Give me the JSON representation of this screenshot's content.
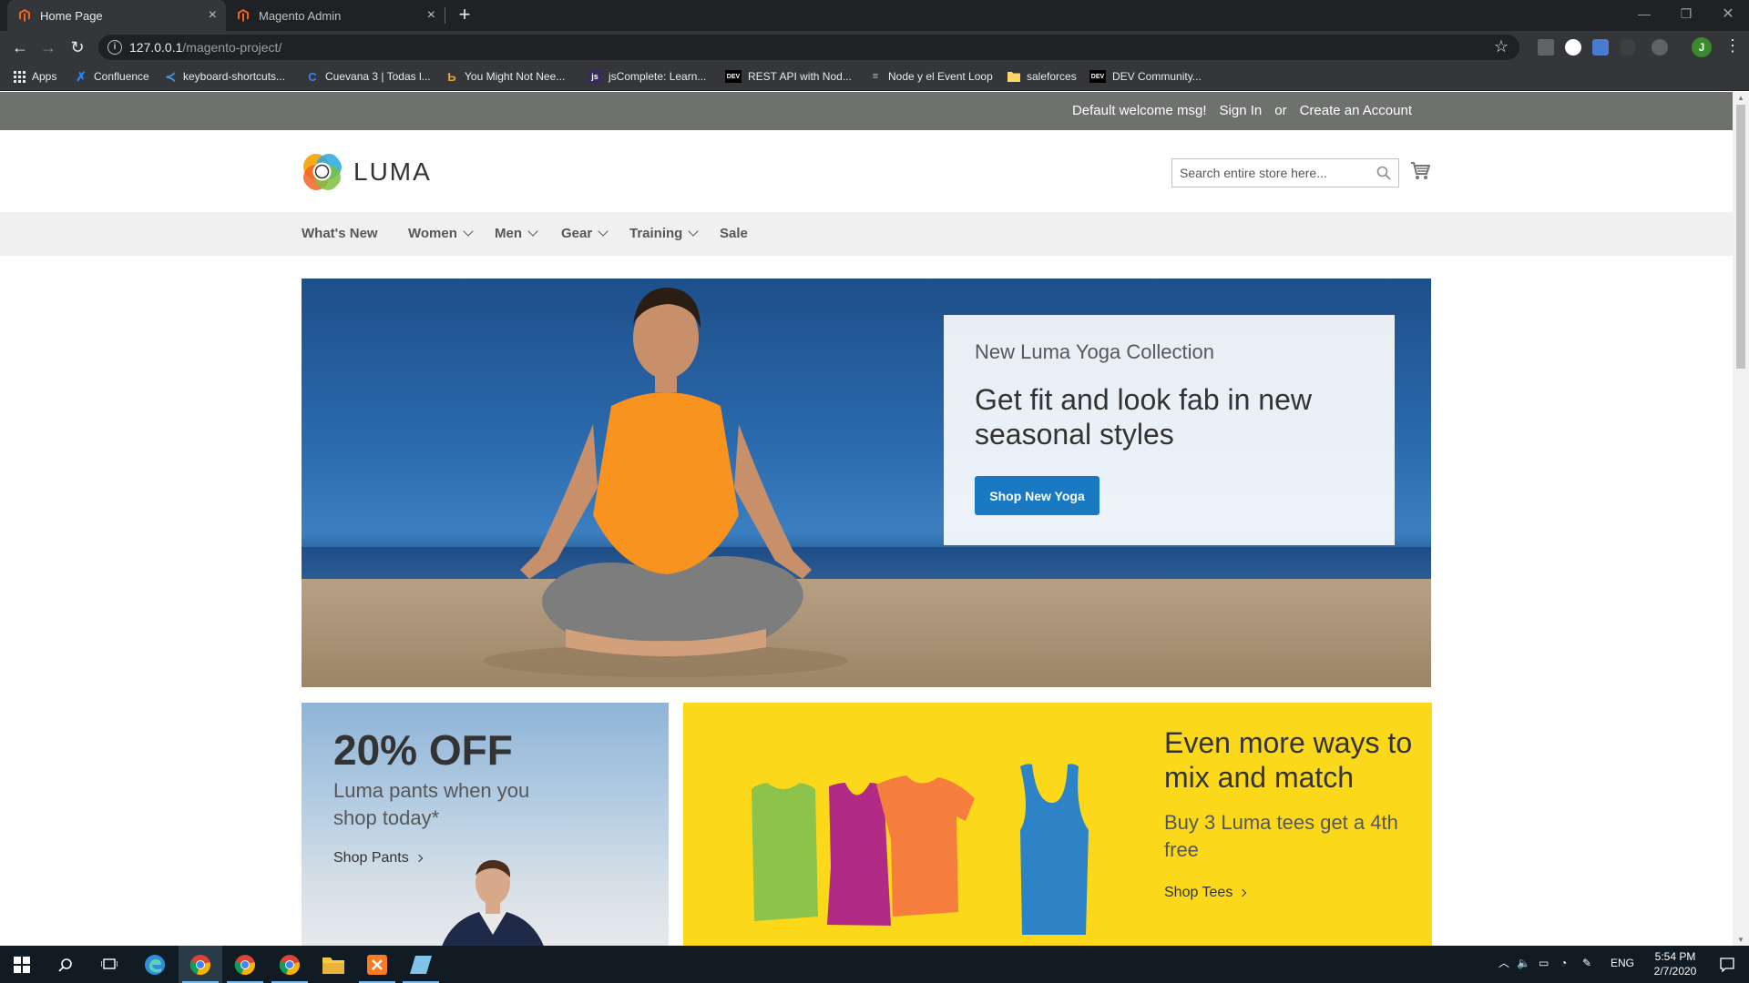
{
  "browser": {
    "tabs": [
      {
        "label": "Home Page",
        "active": true
      },
      {
        "label": "Magento Admin",
        "active": false
      }
    ],
    "url_host": "127.0.0.1",
    "url_path": "/magento-project/",
    "bookmarks": [
      "Apps",
      "Confluence",
      "keyboard-shortcuts...",
      "Cuevana 3 | Todas l...",
      "You Might Not Nee...",
      "jsComplete: Learn...",
      "REST API with Nod...",
      "Node y el Event Loop",
      "saleforces",
      "DEV Community..."
    ],
    "bookmark_badges": {
      "dev": "DEV",
      "js": "js"
    },
    "profile_initial": "J"
  },
  "store": {
    "header": {
      "welcome": "Default welcome msg!",
      "sign_in": "Sign In",
      "or": "or",
      "create_account": "Create an Account"
    },
    "logo_text": "LUMA",
    "search_placeholder": "Search entire store here...",
    "nav": [
      {
        "label": "What's New",
        "dropdown": false
      },
      {
        "label": "Women",
        "dropdown": true
      },
      {
        "label": "Men",
        "dropdown": true
      },
      {
        "label": "Gear",
        "dropdown": true
      },
      {
        "label": "Training",
        "dropdown": true
      },
      {
        "label": "Sale",
        "dropdown": false
      }
    ],
    "hero": {
      "subtitle": "New Luma Yoga Collection",
      "headline": "Get fit and look fab in new seasonal styles",
      "button": "Shop New Yoga"
    },
    "pants_block": {
      "big": "20% OFF",
      "text": "Luma pants when you shop today*",
      "link": "Shop Pants"
    },
    "tees_block": {
      "headline": "Even more ways to mix and match",
      "text": "Buy 3 Luma tees get a 4th free",
      "link": "Shop Tees"
    }
  },
  "taskbar": {
    "language": "ENG",
    "time": "5:54 PM",
    "date": "2/7/2020"
  },
  "colors": {
    "primary_button": "#1979c3",
    "tees_bg": "#fbd91a",
    "header_bar": "#6e716e"
  }
}
